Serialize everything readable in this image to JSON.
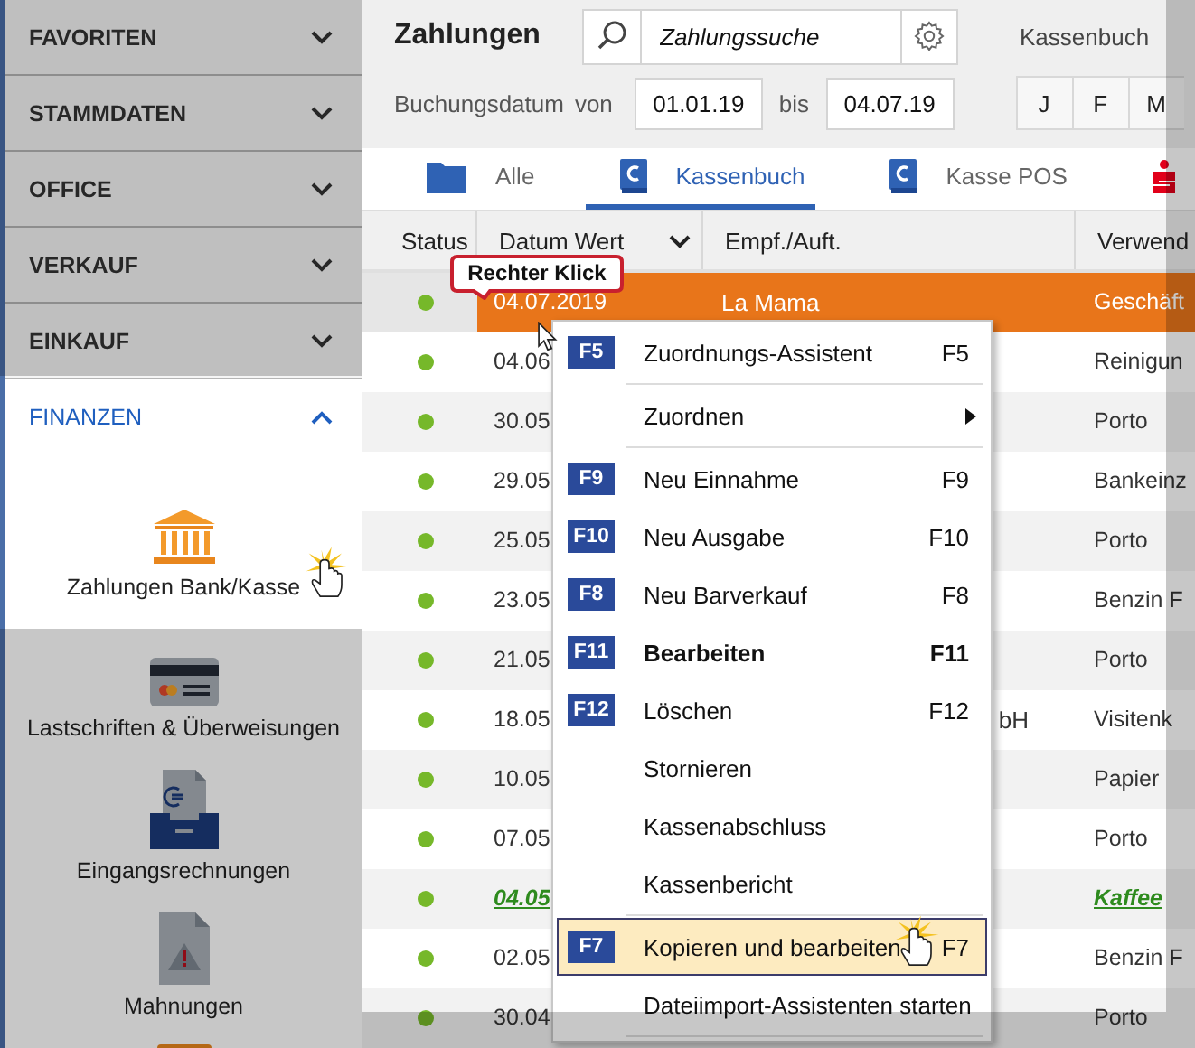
{
  "sidebar": {
    "sections": [
      {
        "label": "FAVORITEN",
        "expanded": false
      },
      {
        "label": "STAMMDATEN",
        "expanded": false
      },
      {
        "label": "OFFICE",
        "expanded": false
      },
      {
        "label": "VERKAUF",
        "expanded": false
      },
      {
        "label": "EINKAUF",
        "expanded": false
      },
      {
        "label": "FINANZEN",
        "expanded": true,
        "items": [
          {
            "kind": "bank",
            "label": "Zahlungen Bank/Kasse",
            "selected": true
          },
          {
            "kind": "card",
            "label": "Lastschriften & Überweisungen",
            "selected": false
          },
          {
            "kind": "inbox",
            "label": "Eingangsrechnungen",
            "selected": false
          },
          {
            "kind": "warning",
            "label": "Mahnungen",
            "selected": false
          },
          {
            "kind": "box",
            "selected": false
          }
        ]
      }
    ]
  },
  "header": {
    "title": "Zahlungen",
    "search": {
      "value": "Zahlungssuche"
    },
    "view_label": "Kassenbuch",
    "date_filter": {
      "label": "Buchungsdatum",
      "from_label": "von",
      "from": "01.01.19",
      "to_label": "bis",
      "to": "04.07.19"
    },
    "months": [
      "J",
      "F",
      "M"
    ]
  },
  "tabs": [
    {
      "label": "Alle",
      "kind": "folder",
      "selected": false
    },
    {
      "label": "Kassenbuch",
      "kind": "book",
      "selected": true
    },
    {
      "label": "Kasse POS",
      "kind": "book",
      "selected": false
    },
    {
      "kind": "bank-s",
      "selected": false
    }
  ],
  "table": {
    "columns": [
      "Status",
      "Datum Wert",
      "Empf./Auft.",
      "Verwend"
    ],
    "rows": [
      {
        "date": "04.07.2019",
        "recipient": "La Mama",
        "purpose": "Geschäft",
        "selected": true,
        "emphasis": false
      },
      {
        "date": "04.06",
        "purpose": "Reinigun",
        "selected": false,
        "emphasis": false
      },
      {
        "date": "30.05",
        "purpose": "Porto",
        "selected": false,
        "emphasis": false
      },
      {
        "date": "29.05",
        "purpose": "Bankeinz",
        "selected": false,
        "emphasis": false
      },
      {
        "date": "25.05",
        "purpose": "Porto",
        "selected": false,
        "emphasis": false
      },
      {
        "date": "23.05",
        "purpose": "Benzin F",
        "selected": false,
        "emphasis": false
      },
      {
        "date": "21.05",
        "purpose": "Porto",
        "selected": false,
        "emphasis": false
      },
      {
        "date": "18.05",
        "recipient": "bH",
        "recipient_tail": true,
        "purpose": "Visitenk",
        "selected": false,
        "emphasis": false
      },
      {
        "date": "10.05",
        "purpose": "Papier",
        "selected": false,
        "emphasis": false
      },
      {
        "date": "07.05",
        "purpose": "Porto",
        "selected": false,
        "emphasis": false
      },
      {
        "date": "04.05",
        "purpose": "Kaffee",
        "selected": false,
        "emphasis": true
      },
      {
        "date": "02.05",
        "purpose": "Benzin F",
        "selected": false,
        "emphasis": false
      },
      {
        "date": "30.04",
        "purpose": "Porto",
        "selected": false,
        "emphasis": false
      }
    ]
  },
  "context_menu": {
    "items": [
      {
        "kind": "item",
        "key": "F5",
        "label": "Zuordnungs-Assistent",
        "shortcut": "F5",
        "bold": false,
        "selected": false
      },
      {
        "kind": "separator"
      },
      {
        "kind": "item",
        "label": "Zuordnen",
        "submenu": true,
        "bold": false,
        "selected": false
      },
      {
        "kind": "separator"
      },
      {
        "kind": "item",
        "key": "F9",
        "label": "Neu Einnahme",
        "shortcut": "F9",
        "bold": false,
        "selected": false
      },
      {
        "kind": "item",
        "key": "F10",
        "label": "Neu Ausgabe",
        "shortcut": "F10",
        "bold": false,
        "selected": false
      },
      {
        "kind": "item",
        "key": "F8",
        "label": "Neu Barverkauf",
        "shortcut": "F8",
        "bold": false,
        "selected": false
      },
      {
        "kind": "item",
        "key": "F11",
        "label": "Bearbeiten",
        "shortcut": "F11",
        "bold": true,
        "selected": false
      },
      {
        "kind": "item",
        "key": "F12",
        "label": "Löschen",
        "shortcut": "F12",
        "bold": false,
        "selected": false
      },
      {
        "kind": "item",
        "label": "Stornieren",
        "bold": false,
        "selected": false
      },
      {
        "kind": "item",
        "label": "Kassenabschluss",
        "bold": false,
        "selected": false
      },
      {
        "kind": "item",
        "label": "Kassenbericht",
        "bold": false,
        "selected": false
      },
      {
        "kind": "separator"
      },
      {
        "kind": "item",
        "key": "F7",
        "label": "Kopieren und bearbeiten",
        "shortcut": "F7",
        "bold": false,
        "selected": true
      },
      {
        "kind": "item",
        "label": "Dateiimport-Assistenten starten",
        "bold": false,
        "selected": false
      },
      {
        "kind": "separator"
      }
    ]
  },
  "callout": {
    "text": "Rechter Klick"
  }
}
